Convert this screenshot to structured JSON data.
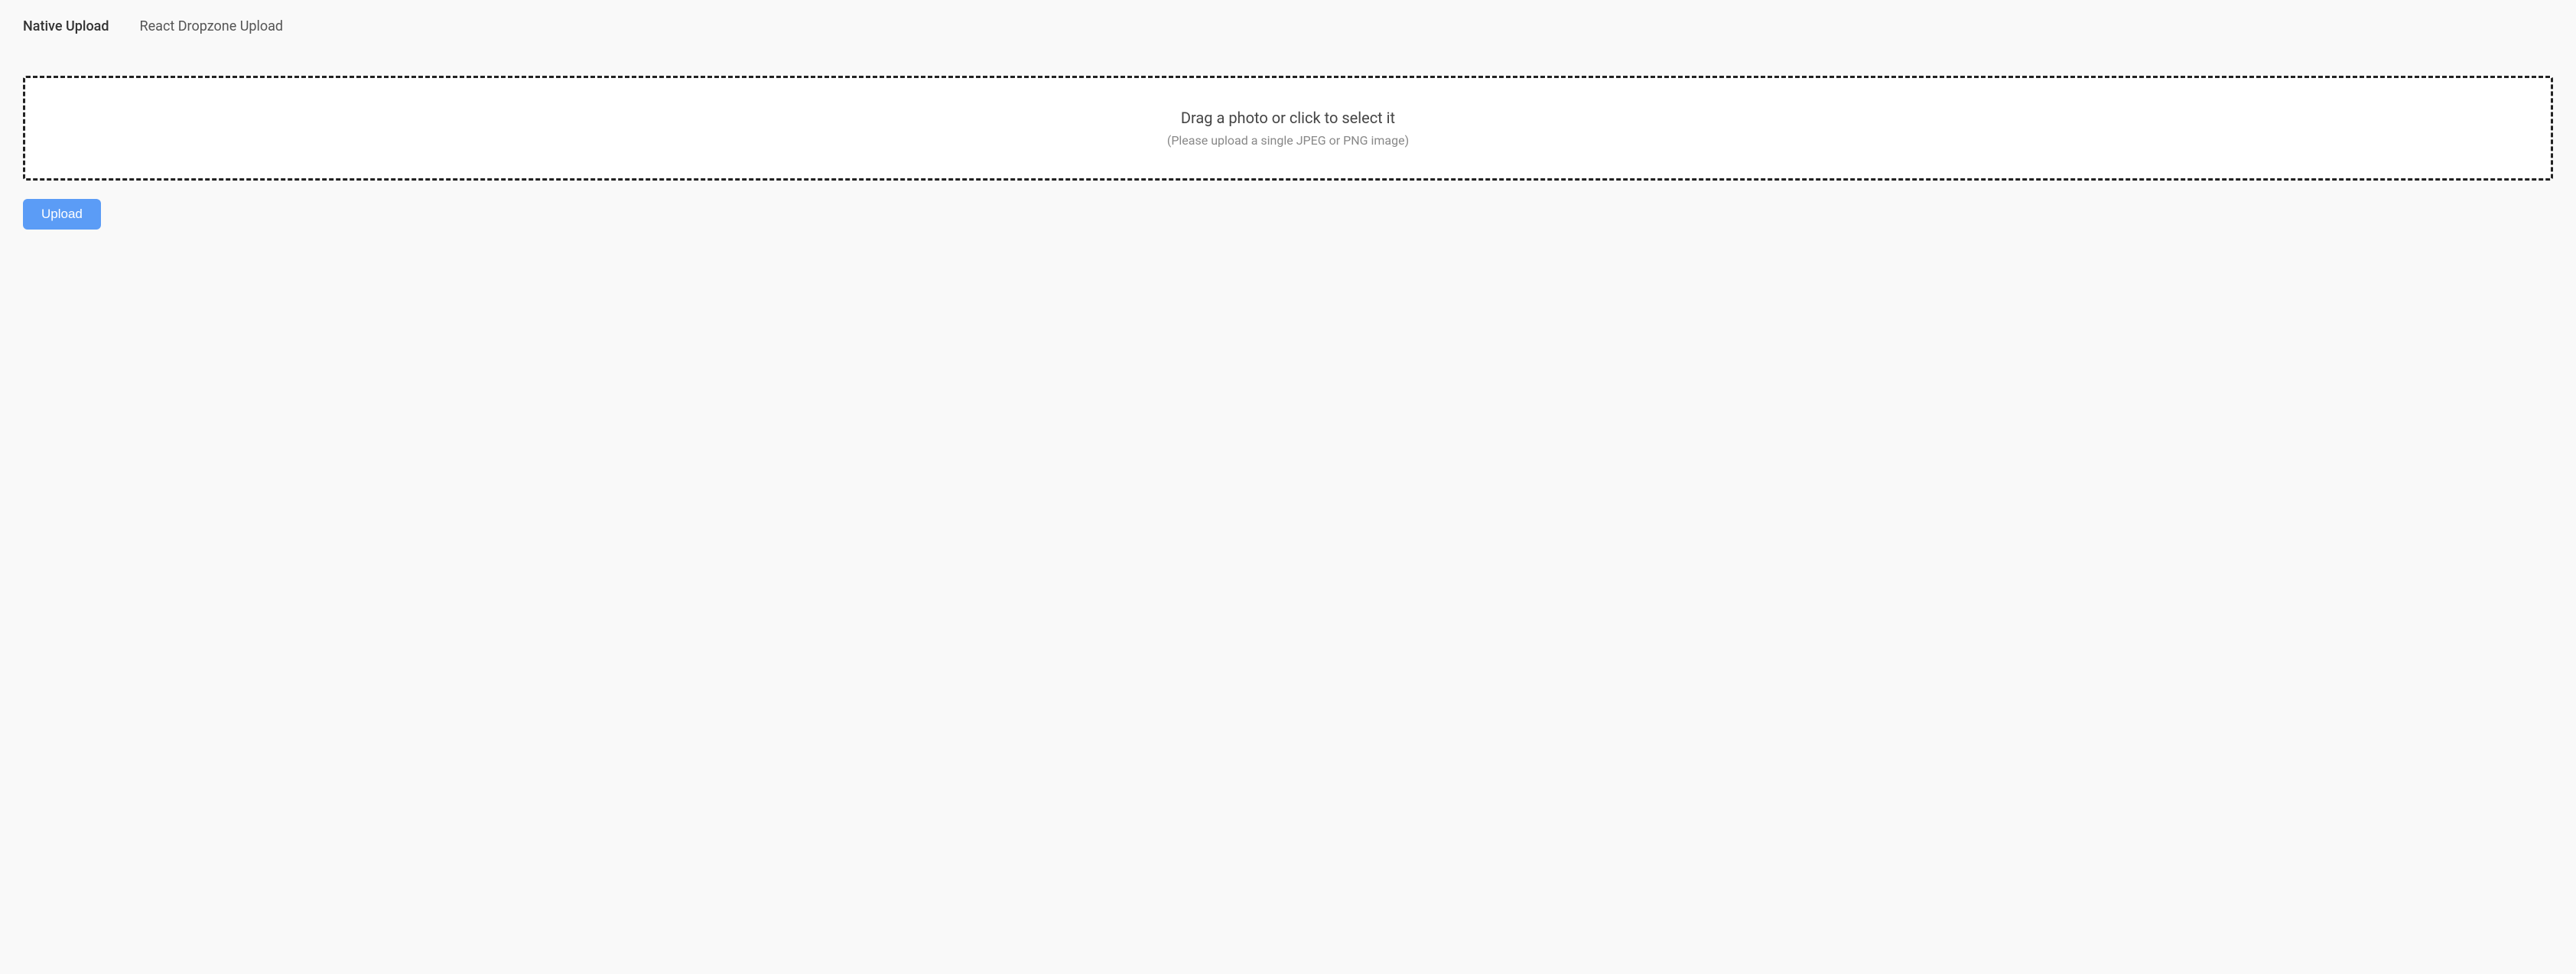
{
  "tabs": [
    {
      "id": "native-upload",
      "label": "Native Upload",
      "active": true
    },
    {
      "id": "react-dropzone-upload",
      "label": "React Dropzone Upload",
      "active": false
    }
  ],
  "dropzone": {
    "main_text": "Drag a photo or click to select it",
    "sub_text": "(Please upload a single JPEG or PNG image)"
  },
  "upload_button": {
    "label": "Upload"
  }
}
